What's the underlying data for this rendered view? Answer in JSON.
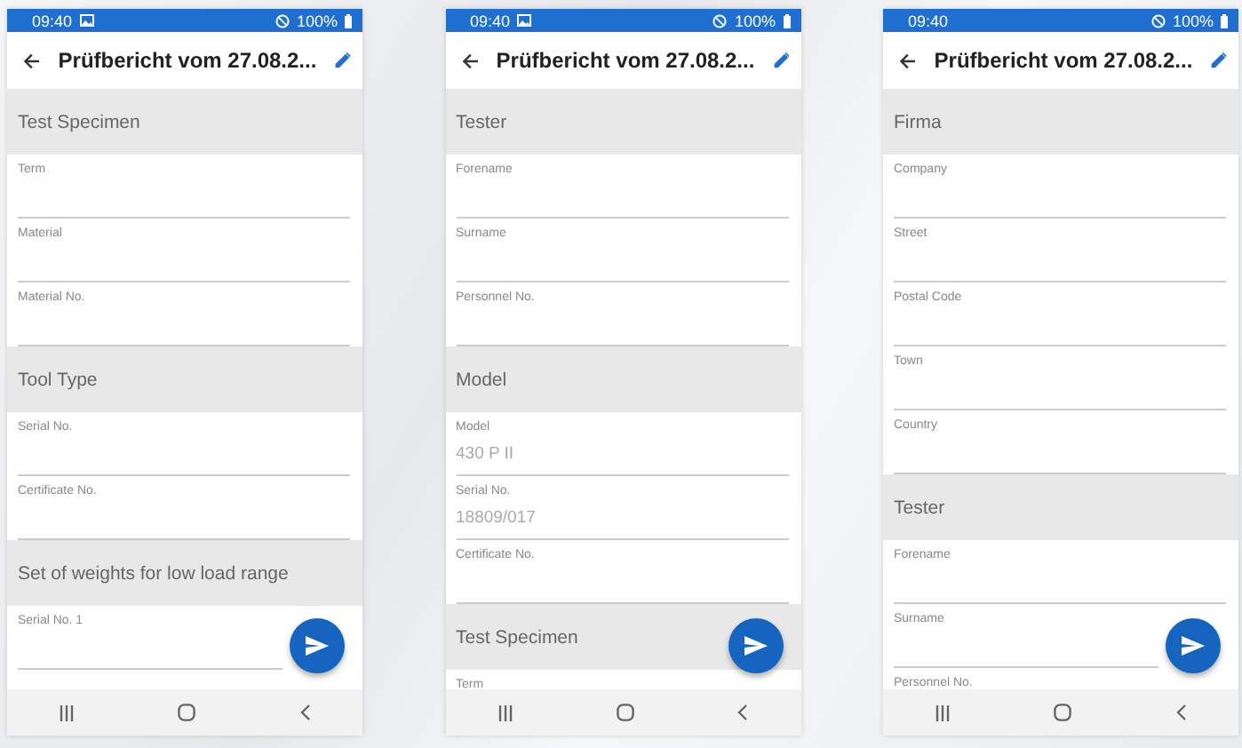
{
  "screens": [
    {
      "status_bar": {
        "time": "09:40",
        "image_icon": true,
        "battery": "100%"
      },
      "title": "Prüfbericht vom 27.08.2...",
      "sections": [
        {
          "title": "Test Specimen",
          "fields": [
            {
              "label": "Term"
            },
            {
              "label": "Material"
            },
            {
              "label": "Material No."
            }
          ]
        },
        {
          "title": "Tool Type",
          "fields": [
            {
              "label": "Serial No."
            },
            {
              "label": "Certificate No."
            }
          ]
        },
        {
          "title": "Set of weights for low load range",
          "fields": [
            {
              "label": "Serial No. 1"
            }
          ]
        }
      ]
    },
    {
      "status_bar": {
        "time": "09:40",
        "image_icon": true,
        "battery": "100%"
      },
      "title": "Prüfbericht vom 27.08.2...",
      "sections": [
        {
          "title": "Tester",
          "fields": [
            {
              "label": "Forename"
            },
            {
              "label": "Surname"
            },
            {
              "label": "Personnel No."
            }
          ]
        },
        {
          "title": "Model",
          "fields": [
            {
              "label": "Model",
              "value": "430 P II"
            },
            {
              "label": "Serial No.",
              "value": "18809/017"
            },
            {
              "label": "Certificate No."
            }
          ]
        },
        {
          "title": "Test Specimen",
          "fields": [
            {
              "label": "Term"
            }
          ]
        }
      ]
    },
    {
      "status_bar": {
        "time": "09:40",
        "image_icon": false,
        "battery": "100%"
      },
      "title": "Prüfbericht vom 27.08.2...",
      "sections": [
        {
          "title": "Firma",
          "fields": [
            {
              "label": "Company"
            },
            {
              "label": "Street"
            },
            {
              "label": "Postal Code"
            },
            {
              "label": "Town"
            },
            {
              "label": "Country"
            }
          ]
        },
        {
          "title": "Tester",
          "fields": [
            {
              "label": "Forename"
            },
            {
              "label": "Surname"
            },
            {
              "label": "Personnel No."
            }
          ]
        }
      ]
    }
  ]
}
